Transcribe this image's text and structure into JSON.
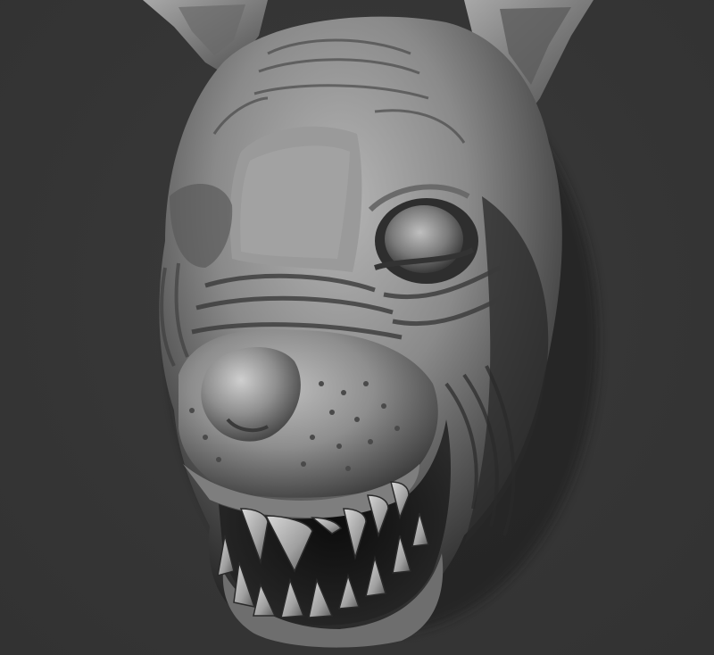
{
  "scene": {
    "subject": "sculpted-creature-head",
    "background_color": "#363636",
    "material_base_color": "#8a8a8a",
    "material_highlight_color": "#cfcfcf",
    "material_shadow_color": "#1a1a1a"
  }
}
